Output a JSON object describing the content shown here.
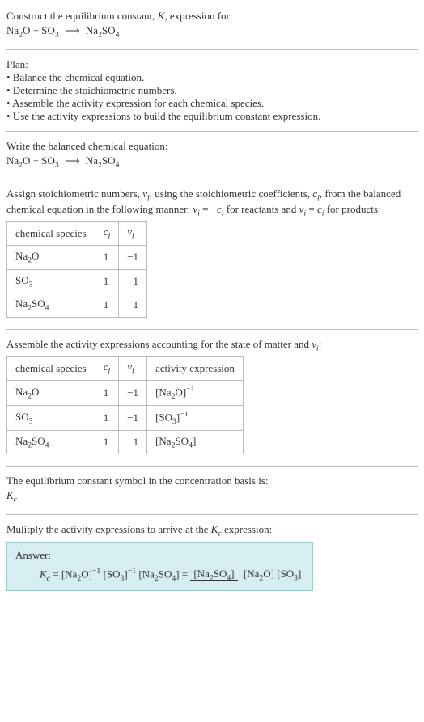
{
  "header": {
    "construct": "Construct the equilibrium constant, ",
    "K": "K",
    "expr_for": ", expression for:"
  },
  "reaction": {
    "r1": "Na",
    "r1s": "2",
    "r1b": "O + SO",
    "r1bs": "3",
    "arrow": "⟶",
    "p1": "Na",
    "p1s": "2",
    "p1b": "SO",
    "p1bs": "4"
  },
  "plan": {
    "title": "Plan:",
    "l1": "• Balance the chemical equation.",
    "l2": "• Determine the stoichiometric numbers.",
    "l3": "• Assemble the activity expression for each chemical species.",
    "l4": "• Use the activity expressions to build the equilibrium constant expression."
  },
  "balanced": {
    "title": "Write the balanced chemical equation:"
  },
  "assign": {
    "t1": "Assign stoichiometric numbers, ",
    "nu": "ν",
    "sub_i": "i",
    "t2": ", using the stoichiometric coefficients, ",
    "c": "c",
    "t3": ", from the balanced chemical equation in the following manner: ",
    "eq1": " = −",
    "t4": " for reactants and ",
    "eq2": " = ",
    "t5": " for products:"
  },
  "table1": {
    "h1": "chemical species",
    "h2": "c",
    "h2s": "i",
    "h3": "ν",
    "h3s": "i",
    "rows": [
      {
        "sp_a": "Na",
        "sp_as": "2",
        "sp_b": "O",
        "c": "1",
        "nu": "−1"
      },
      {
        "sp_a": "SO",
        "sp_as": "3",
        "sp_b": "",
        "c": "1",
        "nu": "−1"
      },
      {
        "sp_a": "Na",
        "sp_as": "2",
        "sp_b": "SO",
        "sp_bs": "4",
        "c": "1",
        "nu": "1"
      }
    ]
  },
  "assemble": {
    "t1": "Assemble the activity expressions accounting for the state of matter and ",
    "t2": ":"
  },
  "table2": {
    "h1": "chemical species",
    "h2": "c",
    "h2s": "i",
    "h3": "ν",
    "h3s": "i",
    "h4": "activity expression",
    "rows": [
      {
        "sp_a": "Na",
        "sp_as": "2",
        "sp_b": "O",
        "c": "1",
        "nu": "−1",
        "ae_a": "[Na",
        "ae_as": "2",
        "ae_b": "O]",
        "ae_exp": "−1"
      },
      {
        "sp_a": "SO",
        "sp_as": "3",
        "sp_b": "",
        "c": "1",
        "nu": "−1",
        "ae_a": "[SO",
        "ae_as": "3",
        "ae_b": "]",
        "ae_exp": "−1"
      },
      {
        "sp_a": "Na",
        "sp_as": "2",
        "sp_b": "SO",
        "sp_bs": "4",
        "c": "1",
        "nu": "1",
        "ae_a": "[Na",
        "ae_as": "2",
        "ae_b": "SO",
        "ae_bs": "4",
        "ae_c": "]",
        "ae_exp": ""
      }
    ]
  },
  "kc_symbol": {
    "t1": "The equilibrium constant symbol in the concentration basis is:",
    "K": "K",
    "c": "c"
  },
  "multiply": {
    "t1": "Mulitply the activity expressions to arrive at the ",
    "K": "K",
    "c": "c",
    "t2": " expression:"
  },
  "answer": {
    "label": "Answer:",
    "K": "K",
    "c": "c",
    "eq": " = [Na",
    "s2": "2",
    "p1": "O]",
    "neg1": "−1",
    "sp": " [SO",
    "s3": "3",
    "p2": "]",
    "sp2": " [Na",
    "p3": "SO",
    "s4": "4",
    "p4": "] = ",
    "num_a": "[Na",
    "num_b": "SO",
    "num_c": "]",
    "den_a": "[Na",
    "den_b": "O] [SO",
    "den_c": "]"
  }
}
